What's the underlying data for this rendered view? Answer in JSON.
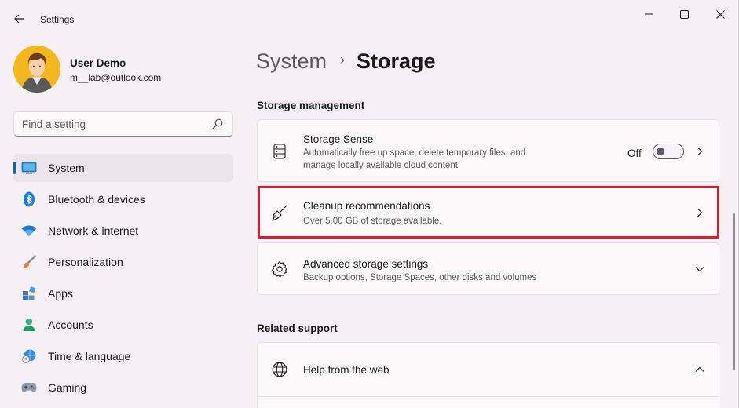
{
  "app": {
    "title": "Settings",
    "user_name": "User Demo",
    "user_email": "m__lab@outlook.com"
  },
  "search": {
    "placeholder": "Find a setting"
  },
  "nav": [
    {
      "label": "System",
      "icon": "system-icon",
      "selected": true
    },
    {
      "label": "Bluetooth & devices",
      "icon": "bluetooth-icon"
    },
    {
      "label": "Network & internet",
      "icon": "wifi-icon"
    },
    {
      "label": "Personalization",
      "icon": "brush-icon"
    },
    {
      "label": "Apps",
      "icon": "apps-icon"
    },
    {
      "label": "Accounts",
      "icon": "person-icon"
    },
    {
      "label": "Time & language",
      "icon": "globe-clock-icon"
    },
    {
      "label": "Gaming",
      "icon": "gamepad-icon"
    }
  ],
  "breadcrumb": {
    "parent": "System",
    "separator": "›",
    "current": "Storage"
  },
  "storage_management": {
    "title": "Storage management",
    "storage_sense": {
      "title": "Storage Sense",
      "desc_line1": "Automatically free up space, delete temporary files, and",
      "desc_line2": "manage locally available cloud content",
      "toggle_label": "Off",
      "toggle_on": false
    },
    "cleanup": {
      "title": "Cleanup recommendations",
      "desc": "Over 5.00 GB of storage available."
    },
    "advanced": {
      "title": "Advanced storage settings",
      "desc": "Backup options, Storage Spaces, other disks and volumes"
    }
  },
  "related_support": {
    "title": "Related support",
    "help_web": {
      "title": "Help from the web"
    }
  },
  "colors": {
    "accent": "#0067c0",
    "highlight": "#d1202e"
  }
}
